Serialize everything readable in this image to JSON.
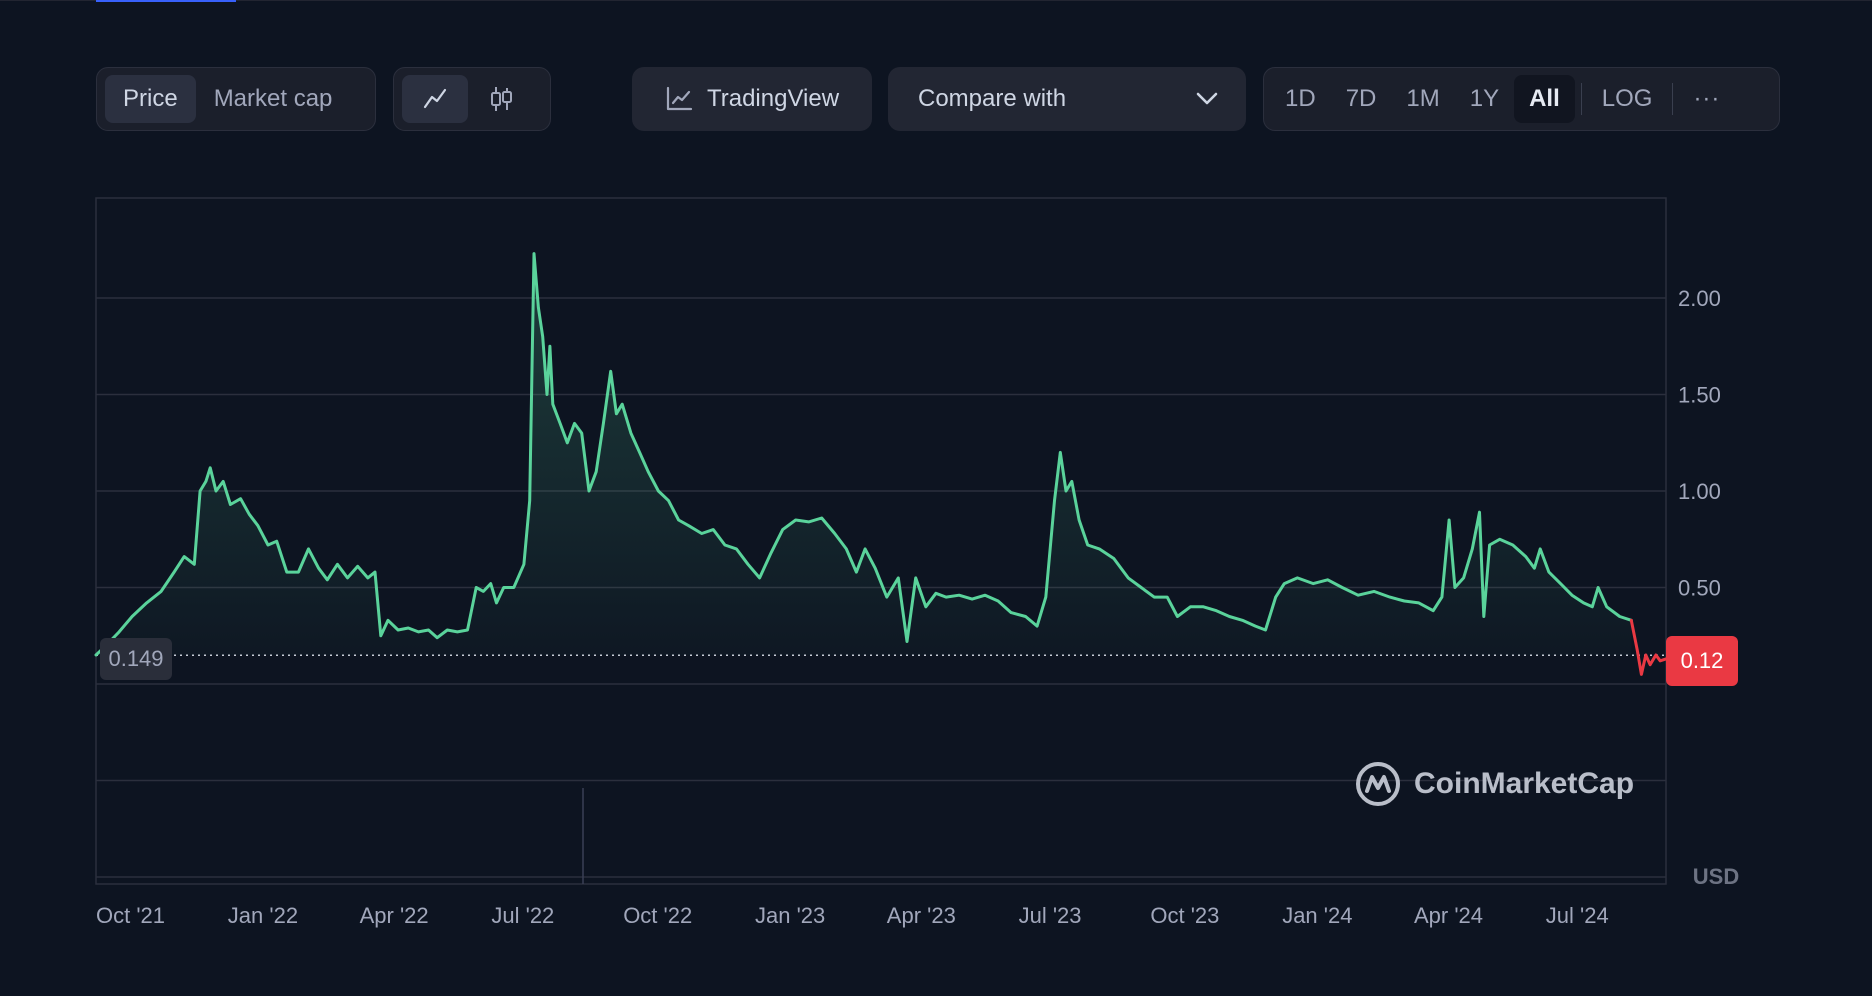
{
  "toolbar": {
    "price_label": "Price",
    "market_cap_label": "Market cap",
    "line_icon": "line-chart-icon",
    "candle_icon": "candlestick-icon",
    "tradingview_label": "TradingView",
    "compare_label": "Compare with",
    "ranges": [
      "1D",
      "7D",
      "1M",
      "1Y",
      "All"
    ],
    "active_range": "All",
    "log_label": "LOG",
    "more_label": "···"
  },
  "colors": {
    "up": "#5ad39b",
    "down": "#ea3943",
    "grid": "#2b2f3d",
    "background": "#0d1421"
  },
  "chart_data": {
    "type": "line",
    "x_tick_labels": [
      "Oct '21",
      "Jan '22",
      "Apr '22",
      "Jul '22",
      "Oct '22",
      "Jan '23",
      "Apr '23",
      "Jul '23",
      "Oct '23",
      "Jan '24",
      "Apr '24",
      "Jul '24"
    ],
    "y_tick_labels": [
      "2.00",
      "1.50",
      "1.00",
      "0.50"
    ],
    "y_ticks": [
      2.0,
      1.5,
      1.0,
      0.5
    ],
    "ylim": [
      -1.0,
      2.5
    ],
    "x_range": [
      "2021-09-15",
      "2024-09-05"
    ],
    "unit_label": "USD",
    "start_value": 0.149,
    "start_label": "0.149",
    "current_value": 0.12,
    "current_label": "0.12",
    "watermark": "CoinMarketCap",
    "series": [
      {
        "points": [
          [
            "2021-09-15",
            0.15
          ],
          [
            "2021-09-22",
            0.2
          ],
          [
            "2021-10-01",
            0.27
          ],
          [
            "2021-10-10",
            0.35
          ],
          [
            "2021-10-20",
            0.42
          ],
          [
            "2021-10-30",
            0.48
          ],
          [
            "2021-11-08",
            0.58
          ],
          [
            "2021-11-15",
            0.66
          ],
          [
            "2021-11-22",
            0.62
          ],
          [
            "2021-11-26",
            1.0
          ],
          [
            "2021-11-30",
            1.05
          ],
          [
            "2021-12-03",
            1.12
          ],
          [
            "2021-12-07",
            1.0
          ],
          [
            "2021-12-12",
            1.05
          ],
          [
            "2021-12-17",
            0.93
          ],
          [
            "2021-12-24",
            0.96
          ],
          [
            "2021-12-30",
            0.88
          ],
          [
            "2022-01-05",
            0.82
          ],
          [
            "2022-01-12",
            0.72
          ],
          [
            "2022-01-18",
            0.74
          ],
          [
            "2022-01-25",
            0.58
          ],
          [
            "2022-02-02",
            0.58
          ],
          [
            "2022-02-09",
            0.7
          ],
          [
            "2022-02-16",
            0.6
          ],
          [
            "2022-02-22",
            0.54
          ],
          [
            "2022-03-01",
            0.62
          ],
          [
            "2022-03-08",
            0.55
          ],
          [
            "2022-03-15",
            0.61
          ],
          [
            "2022-03-22",
            0.55
          ],
          [
            "2022-03-27",
            0.58
          ],
          [
            "2022-03-31",
            0.25
          ],
          [
            "2022-04-05",
            0.33
          ],
          [
            "2022-04-12",
            0.28
          ],
          [
            "2022-04-19",
            0.29
          ],
          [
            "2022-04-26",
            0.27
          ],
          [
            "2022-05-03",
            0.28
          ],
          [
            "2022-05-09",
            0.24
          ],
          [
            "2022-05-16",
            0.28
          ],
          [
            "2022-05-23",
            0.27
          ],
          [
            "2022-05-30",
            0.28
          ],
          [
            "2022-06-05",
            0.5
          ],
          [
            "2022-06-10",
            0.48
          ],
          [
            "2022-06-15",
            0.52
          ],
          [
            "2022-06-19",
            0.42
          ],
          [
            "2022-06-24",
            0.5
          ],
          [
            "2022-07-01",
            0.5
          ],
          [
            "2022-07-08",
            0.62
          ],
          [
            "2022-07-12",
            0.95
          ],
          [
            "2022-07-15",
            2.23
          ],
          [
            "2022-07-18",
            1.95
          ],
          [
            "2022-07-21",
            1.8
          ],
          [
            "2022-07-24",
            1.5
          ],
          [
            "2022-07-26",
            1.75
          ],
          [
            "2022-07-28",
            1.45
          ],
          [
            "2022-08-02",
            1.35
          ],
          [
            "2022-08-07",
            1.25
          ],
          [
            "2022-08-12",
            1.35
          ],
          [
            "2022-08-17",
            1.3
          ],
          [
            "2022-08-22",
            1.0
          ],
          [
            "2022-08-27",
            1.1
          ],
          [
            "2022-09-01",
            1.35
          ],
          [
            "2022-09-06",
            1.62
          ],
          [
            "2022-09-10",
            1.4
          ],
          [
            "2022-09-14",
            1.45
          ],
          [
            "2022-09-20",
            1.3
          ],
          [
            "2022-09-26",
            1.2
          ],
          [
            "2022-10-02",
            1.1
          ],
          [
            "2022-10-09",
            1.0
          ],
          [
            "2022-10-16",
            0.95
          ],
          [
            "2022-10-23",
            0.85
          ],
          [
            "2022-10-30",
            0.82
          ],
          [
            "2022-11-08",
            0.78
          ],
          [
            "2022-11-16",
            0.8
          ],
          [
            "2022-11-24",
            0.72
          ],
          [
            "2022-12-02",
            0.7
          ],
          [
            "2022-12-10",
            0.62
          ],
          [
            "2022-12-18",
            0.55
          ],
          [
            "2022-12-26",
            0.68
          ],
          [
            "2023-01-03",
            0.8
          ],
          [
            "2023-01-12",
            0.85
          ],
          [
            "2023-01-21",
            0.84
          ],
          [
            "2023-01-30",
            0.86
          ],
          [
            "2023-02-08",
            0.78
          ],
          [
            "2023-02-16",
            0.7
          ],
          [
            "2023-02-23",
            0.58
          ],
          [
            "2023-03-01",
            0.7
          ],
          [
            "2023-03-08",
            0.6
          ],
          [
            "2023-03-16",
            0.45
          ],
          [
            "2023-03-24",
            0.55
          ],
          [
            "2023-03-30",
            0.22
          ],
          [
            "2023-04-05",
            0.55
          ],
          [
            "2023-04-12",
            0.4
          ],
          [
            "2023-04-19",
            0.47
          ],
          [
            "2023-04-26",
            0.45
          ],
          [
            "2023-05-05",
            0.46
          ],
          [
            "2023-05-14",
            0.44
          ],
          [
            "2023-05-23",
            0.46
          ],
          [
            "2023-06-01",
            0.43
          ],
          [
            "2023-06-10",
            0.37
          ],
          [
            "2023-06-20",
            0.35
          ],
          [
            "2023-06-28",
            0.3
          ],
          [
            "2023-07-04",
            0.45
          ],
          [
            "2023-07-10",
            0.95
          ],
          [
            "2023-07-14",
            1.2
          ],
          [
            "2023-07-18",
            1.0
          ],
          [
            "2023-07-22",
            1.05
          ],
          [
            "2023-07-27",
            0.85
          ],
          [
            "2023-08-02",
            0.72
          ],
          [
            "2023-08-10",
            0.7
          ],
          [
            "2023-08-20",
            0.65
          ],
          [
            "2023-08-30",
            0.55
          ],
          [
            "2023-09-08",
            0.5
          ],
          [
            "2023-09-17",
            0.45
          ],
          [
            "2023-09-26",
            0.45
          ],
          [
            "2023-10-03",
            0.35
          ],
          [
            "2023-10-12",
            0.4
          ],
          [
            "2023-10-21",
            0.4
          ],
          [
            "2023-10-30",
            0.38
          ],
          [
            "2023-11-08",
            0.35
          ],
          [
            "2023-11-17",
            0.33
          ],
          [
            "2023-11-26",
            0.3
          ],
          [
            "2023-12-03",
            0.28
          ],
          [
            "2023-12-10",
            0.45
          ],
          [
            "2023-12-16",
            0.52
          ],
          [
            "2023-12-25",
            0.55
          ],
          [
            "2024-01-05",
            0.52
          ],
          [
            "2024-01-15",
            0.54
          ],
          [
            "2024-01-25",
            0.5
          ],
          [
            "2024-02-05",
            0.46
          ],
          [
            "2024-02-16",
            0.48
          ],
          [
            "2024-02-27",
            0.45
          ],
          [
            "2024-03-08",
            0.43
          ],
          [
            "2024-03-18",
            0.42
          ],
          [
            "2024-03-28",
            0.38
          ],
          [
            "2024-04-03",
            0.45
          ],
          [
            "2024-04-08",
            0.85
          ],
          [
            "2024-04-12",
            0.5
          ],
          [
            "2024-04-18",
            0.55
          ],
          [
            "2024-04-24",
            0.7
          ],
          [
            "2024-04-29",
            0.89
          ],
          [
            "2024-05-02",
            0.35
          ],
          [
            "2024-05-06",
            0.72
          ],
          [
            "2024-05-13",
            0.75
          ],
          [
            "2024-05-22",
            0.72
          ],
          [
            "2024-05-31",
            0.66
          ],
          [
            "2024-06-06",
            0.6
          ],
          [
            "2024-06-10",
            0.7
          ],
          [
            "2024-06-16",
            0.58
          ],
          [
            "2024-06-24",
            0.52
          ],
          [
            "2024-07-02",
            0.46
          ],
          [
            "2024-07-10",
            0.42
          ],
          [
            "2024-07-16",
            0.4
          ],
          [
            "2024-07-20",
            0.5
          ],
          [
            "2024-07-26",
            0.4
          ],
          [
            "2024-08-04",
            0.35
          ],
          [
            "2024-08-12",
            0.33
          ]
        ]
      },
      {
        "color": "down",
        "points": [
          [
            "2024-08-12",
            0.33
          ],
          [
            "2024-08-16",
            0.18
          ],
          [
            "2024-08-19",
            0.05
          ],
          [
            "2024-08-22",
            0.15
          ],
          [
            "2024-08-25",
            0.1
          ],
          [
            "2024-08-29",
            0.15
          ],
          [
            "2024-09-01",
            0.12
          ],
          [
            "2024-09-05",
            0.13
          ]
        ]
      }
    ]
  }
}
